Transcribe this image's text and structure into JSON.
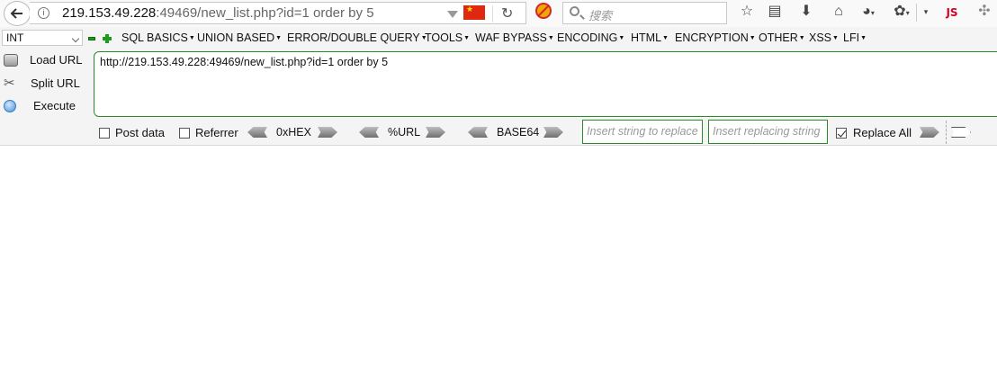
{
  "browser": {
    "url_host": "219.153.49.228",
    "url_rest": ":49469/new_list.php?id=1 order by 5",
    "search_placeholder": "搜索",
    "js_icon_label": "JS",
    "icons": [
      "back-icon",
      "info-icon",
      "dropmarker-icon",
      "china-flag-icon",
      "reload-icon",
      "block-icon",
      "search-icon",
      "bookmark-star-icon",
      "reading-list-icon",
      "download-icon",
      "home-icon",
      "globe-icon",
      "palette-icon",
      "menu-chevron-icon",
      "js-icon",
      "extension-icon"
    ]
  },
  "hackbar": {
    "type_select": "INT",
    "menus": [
      "SQL BASICS",
      "UNION BASED",
      "ERROR/DOUBLE QUERY",
      "TOOLS",
      "WAF BYPASS",
      "ENCODING",
      "HTML",
      "ENCRYPTION",
      "OTHER",
      "XSS",
      "LFI"
    ],
    "side_buttons": {
      "load": "Load URL",
      "split": "Split URL",
      "execute": "Execute"
    },
    "url_field": "http://219.153.49.228:49469/new_list.php?id=1 order by 5",
    "options": {
      "post_data": "Post data",
      "referrer": "Referrer",
      "hex": "0xHEX",
      "url": "%URL",
      "base64": "BASE64",
      "replace_placeholder": "Insert string to replace",
      "replacing_placeholder": "Insert replacing string",
      "replace_all": "Replace All"
    },
    "accent_color": "#2a8a2a"
  }
}
